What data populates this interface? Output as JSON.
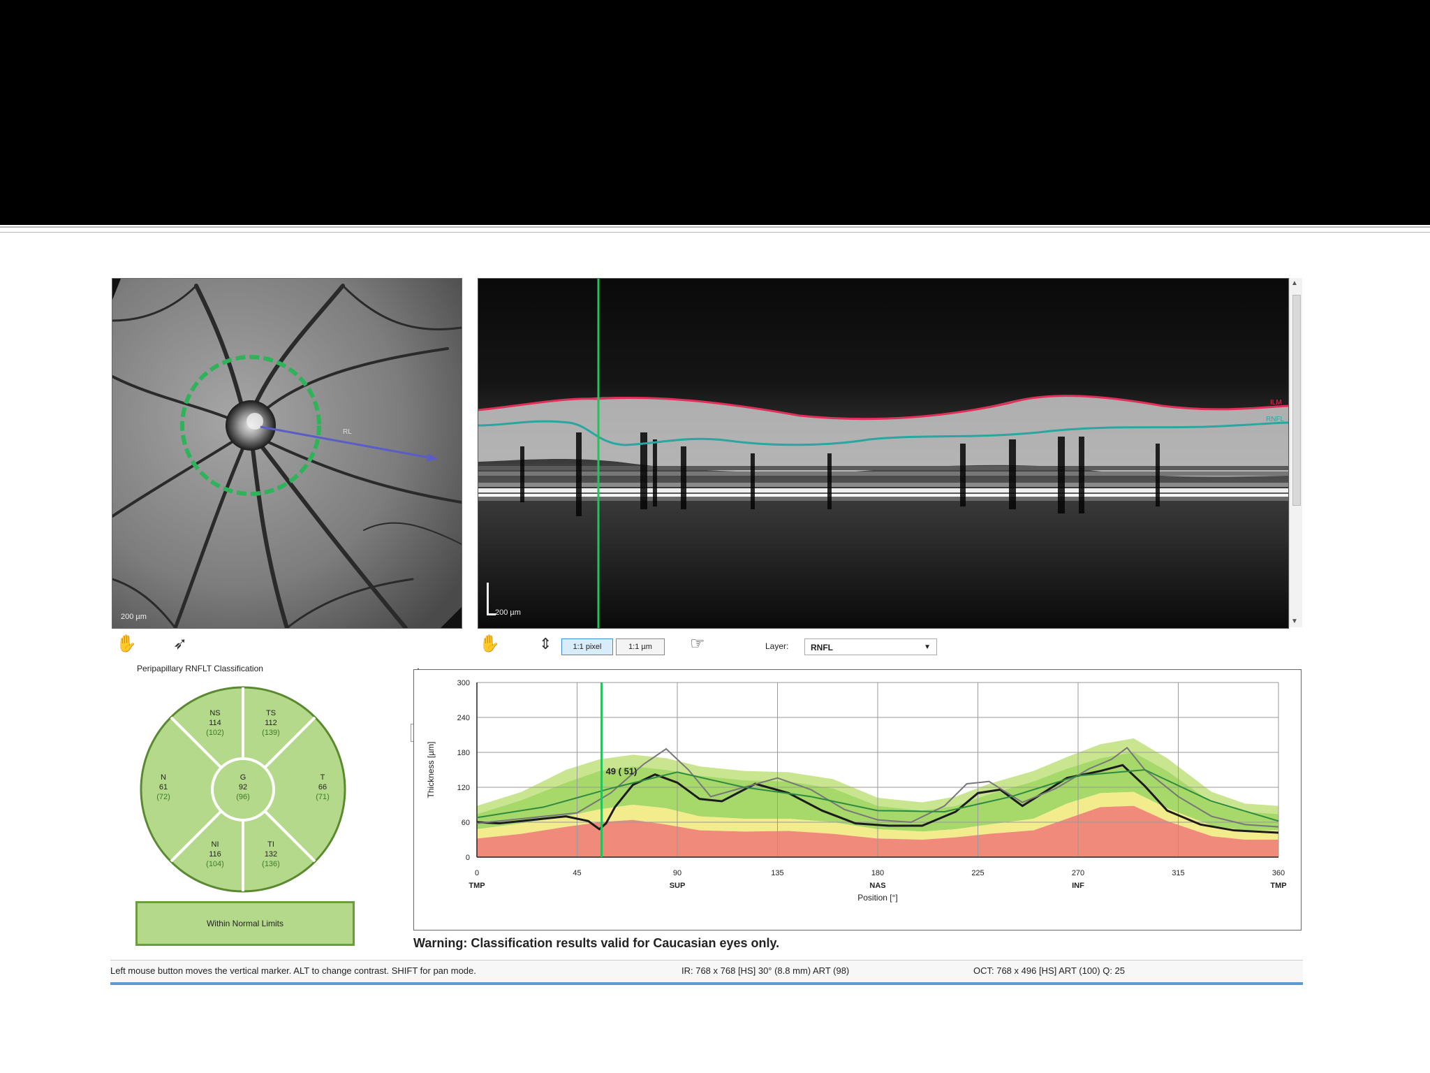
{
  "slide": {
    "background_top": "#000000"
  },
  "fundus": {
    "scale_label": "200 µm",
    "scan_label": "RL",
    "circle_color": "#2fb35a",
    "arrow_color": "#5a5cc8"
  },
  "oct": {
    "scale_label": "200 µm",
    "ilm_label": "ILM",
    "rnfl_label": "RNFL",
    "marker_color": "#22c35a",
    "ilm_color": "#e0305a",
    "rnfl_color": "#2aa6a0"
  },
  "toolbar": {
    "hand_icon": "hand-icon",
    "pointer_icon": "pointer-icon",
    "pan_icon": "pan-icon",
    "height_icon": "height-icon",
    "btn_pixel": "1:1 pixel",
    "btn_um": "1:1 µm",
    "cursor_icon": "cursor-icon",
    "layer_label": "Layer:",
    "layer_value": "RNFL"
  },
  "classification": {
    "title": "Peripapillary RNFLT Classification",
    "segments": [
      {
        "name": "NS",
        "value": "114",
        "normal": "(102)"
      },
      {
        "name": "TS",
        "value": "112",
        "normal": "(139)"
      },
      {
        "name": "N",
        "value": "61",
        "normal": "(72)"
      },
      {
        "name": "G",
        "value": "92",
        "normal": "(96)"
      },
      {
        "name": "T",
        "value": "66",
        "normal": "(71)"
      },
      {
        "name": "NI",
        "value": "116",
        "normal": "(104)"
      },
      {
        "name": "TI",
        "value": "132",
        "normal": "(136)"
      }
    ],
    "result": "Within Normal Limits",
    "fill_color": "#b5d98a"
  },
  "chart_data": {
    "type": "line",
    "ylabel": "Thickness [µm]",
    "xlabel": "Position [°]",
    "xlim": [
      0,
      360
    ],
    "ylim": [
      0,
      300
    ],
    "x_ticks": [
      0,
      45,
      90,
      135,
      180,
      225,
      270,
      315,
      360
    ],
    "y_ticks": [
      0,
      60,
      120,
      180,
      240,
      300
    ],
    "sector_labels": [
      {
        "x": 0,
        "label": "TMP"
      },
      {
        "x": 90,
        "label": "SUP"
      },
      {
        "x": 180,
        "label": "NAS"
      },
      {
        "x": 270,
        "label": "INF"
      },
      {
        "x": 360,
        "label": "TMP"
      }
    ],
    "marker": {
      "x": 56,
      "label": "49 ( 51)"
    },
    "bands": {
      "x": [
        0,
        20,
        40,
        55,
        70,
        85,
        100,
        120,
        140,
        160,
        180,
        200,
        215,
        230,
        250,
        265,
        280,
        295,
        310,
        330,
        345,
        360
      ],
      "red_upper": [
        32,
        40,
        52,
        60,
        64,
        56,
        46,
        44,
        45,
        40,
        32,
        30,
        34,
        40,
        46,
        66,
        86,
        88,
        62,
        36,
        30,
        30
      ],
      "yellow_upper": [
        48,
        58,
        70,
        82,
        90,
        84,
        70,
        66,
        66,
        60,
        48,
        44,
        48,
        56,
        66,
        92,
        110,
        112,
        84,
        54,
        46,
        46
      ],
      "green_upper": [
        74,
        98,
        128,
        148,
        156,
        150,
        140,
        132,
        130,
        118,
        88,
        80,
        88,
        108,
        130,
        152,
        170,
        180,
        148,
        94,
        78,
        74
      ],
      "light_upper": [
        88,
        112,
        150,
        168,
        176,
        170,
        156,
        148,
        146,
        134,
        102,
        94,
        104,
        126,
        148,
        172,
        194,
        204,
        170,
        112,
        92,
        88
      ]
    },
    "series": [
      {
        "color": "#1b1b1b",
        "x": [
          0,
          10,
          25,
          40,
          50,
          55,
          58,
          62,
          70,
          80,
          90,
          100,
          110,
          125,
          140,
          155,
          170,
          185,
          200,
          215,
          225,
          235,
          245,
          255,
          265,
          280,
          290,
          300,
          310,
          325,
          340,
          360
        ],
        "y": [
          60,
          58,
          64,
          70,
          62,
          48,
          58,
          86,
          124,
          142,
          128,
          100,
          96,
          126,
          110,
          80,
          58,
          54,
          54,
          78,
          110,
          116,
          88,
          112,
          136,
          148,
          158,
          122,
          80,
          56,
          46,
          42
        ]
      },
      {
        "color": "#777777",
        "x": [
          0,
          15,
          30,
          45,
          60,
          75,
          85,
          95,
          105,
          120,
          135,
          150,
          165,
          180,
          195,
          210,
          220,
          230,
          245,
          260,
          275,
          285,
          292,
          300,
          315,
          330,
          345,
          360
        ],
        "y": [
          58,
          64,
          70,
          76,
          110,
          160,
          186,
          150,
          104,
          120,
          136,
          116,
          82,
          64,
          60,
          88,
          126,
          130,
          94,
          118,
          152,
          168,
          188,
          150,
          104,
          70,
          56,
          52
        ]
      },
      {
        "color": "#2e8a3e",
        "x": [
          0,
          30,
          60,
          90,
          120,
          150,
          180,
          210,
          240,
          270,
          300,
          330,
          360
        ],
        "y": [
          68,
          86,
          118,
          146,
          120,
          104,
          80,
          78,
          104,
          140,
          150,
          96,
          62
        ]
      }
    ]
  },
  "warning": "Warning: Classification results valid for Caucasian eyes only.",
  "status": {
    "left": "Left mouse button moves the vertical marker. ALT to change contrast. SHIFT for pan mode.",
    "ir": "IR: 768 x 768 [HS] 30° (8.8 mm) ART (98)",
    "oct": "OCT: 768 x 496 [HS] ART (100) Q: 25"
  }
}
